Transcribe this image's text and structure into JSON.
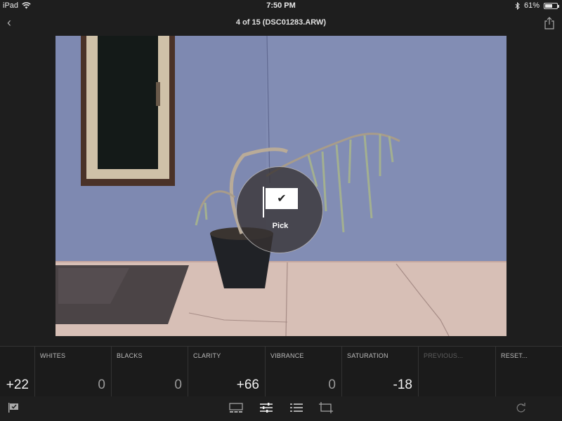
{
  "status": {
    "device": "iPad",
    "time": "7:50 PM",
    "battery_text": "61%",
    "battery_level": 0.61
  },
  "header": {
    "title": "4 of 15 (DSC01283.ARW)"
  },
  "overlay": {
    "label": "Pick",
    "check": "✔"
  },
  "adjustments": [
    {
      "label": "",
      "value": "+22"
    },
    {
      "label": "WHITES",
      "value": "0"
    },
    {
      "label": "BLACKS",
      "value": "0"
    },
    {
      "label": "CLARITY",
      "value": "+66"
    },
    {
      "label": "VIBRANCE",
      "value": "0"
    },
    {
      "label": "SATURATION",
      "value": "-18"
    },
    {
      "label": "PREVIOUS...",
      "value": ""
    },
    {
      "label": "RESET...",
      "value": ""
    }
  ],
  "colors": {
    "background": "#1e1e1e",
    "wall": "#7f8ab0",
    "sidewalk": "#d7bfb6"
  }
}
